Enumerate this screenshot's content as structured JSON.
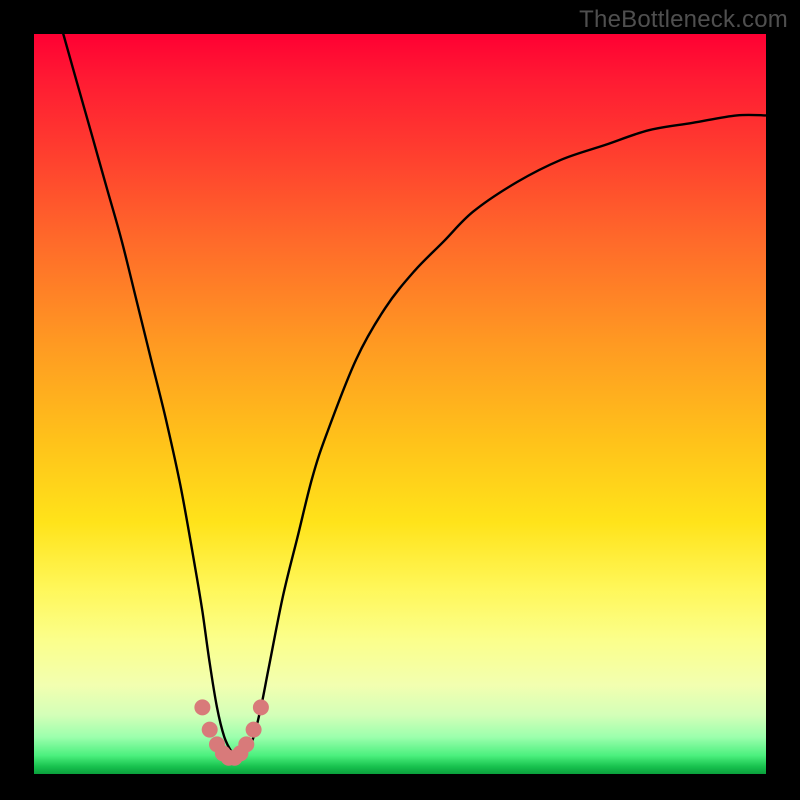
{
  "watermark": "TheBottleneck.com",
  "chart_data": {
    "type": "line",
    "title": "",
    "xlabel": "",
    "ylabel": "",
    "xlim": [
      0,
      100
    ],
    "ylim": [
      0,
      100
    ],
    "series": [
      {
        "name": "bottleneck-curve",
        "x": [
          4,
          6,
          8,
          10,
          12,
          14,
          16,
          18,
          20,
          22,
          23,
          24,
          25,
          26,
          27,
          28,
          29,
          30,
          31,
          32,
          34,
          36,
          38,
          40,
          44,
          48,
          52,
          56,
          60,
          66,
          72,
          78,
          84,
          90,
          96,
          100
        ],
        "values": [
          100,
          93,
          86,
          79,
          72,
          64,
          56,
          48,
          39,
          28,
          22,
          15,
          9,
          5,
          3,
          2,
          3,
          5,
          9,
          14,
          24,
          32,
          40,
          46,
          56,
          63,
          68,
          72,
          76,
          80,
          83,
          85,
          87,
          88,
          89,
          89
        ]
      }
    ],
    "markers": {
      "name": "valley-dots",
      "color": "#d87a7a",
      "x": [
        23.0,
        24.0,
        25.0,
        25.8,
        26.6,
        27.4,
        28.2,
        29.0,
        30.0,
        31.0
      ],
      "y": [
        9.0,
        6.0,
        4.0,
        2.8,
        2.2,
        2.2,
        2.8,
        4.0,
        6.0,
        9.0
      ]
    },
    "colors": {
      "curve": "#000000",
      "marker": "#d87a7a",
      "gradient_top": "#ff0033",
      "gradient_bottom": "#0aa03c"
    }
  }
}
